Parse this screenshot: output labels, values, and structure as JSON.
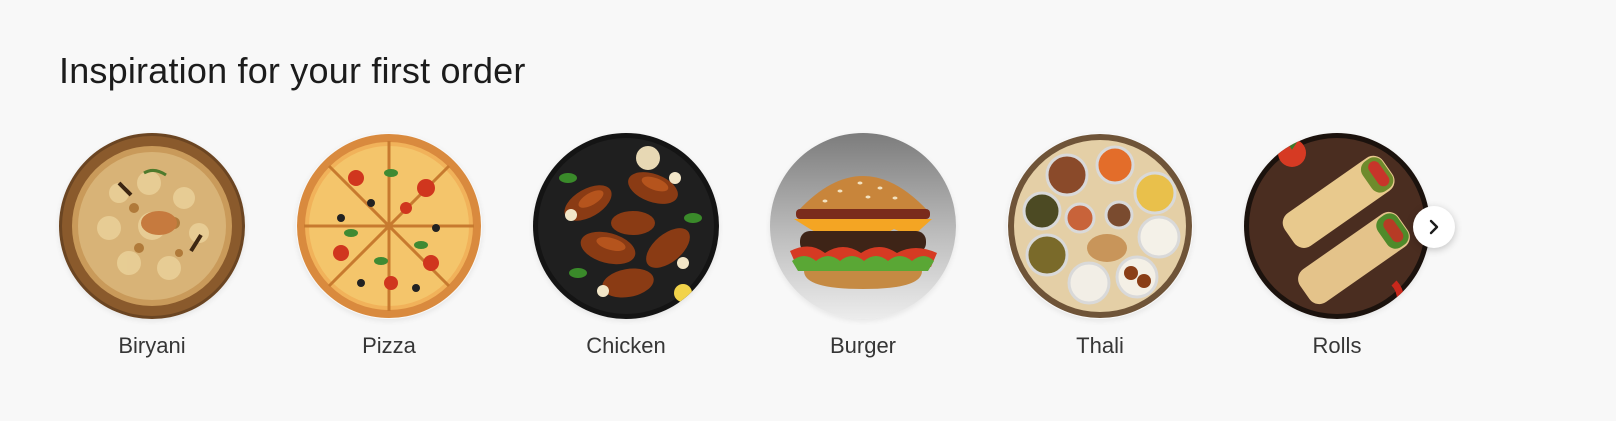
{
  "section": {
    "title": "Inspiration for your first order"
  },
  "carousel": {
    "items": [
      {
        "label": "Biryani",
        "image_icon": "biryani-image"
      },
      {
        "label": "Pizza",
        "image_icon": "pizza-image"
      },
      {
        "label": "Chicken",
        "image_icon": "chicken-image"
      },
      {
        "label": "Burger",
        "image_icon": "burger-image"
      },
      {
        "label": "Thali",
        "image_icon": "thali-image"
      },
      {
        "label": "Rolls",
        "image_icon": "rolls-image"
      }
    ],
    "next_button_icon": "chevron-right-icon"
  }
}
